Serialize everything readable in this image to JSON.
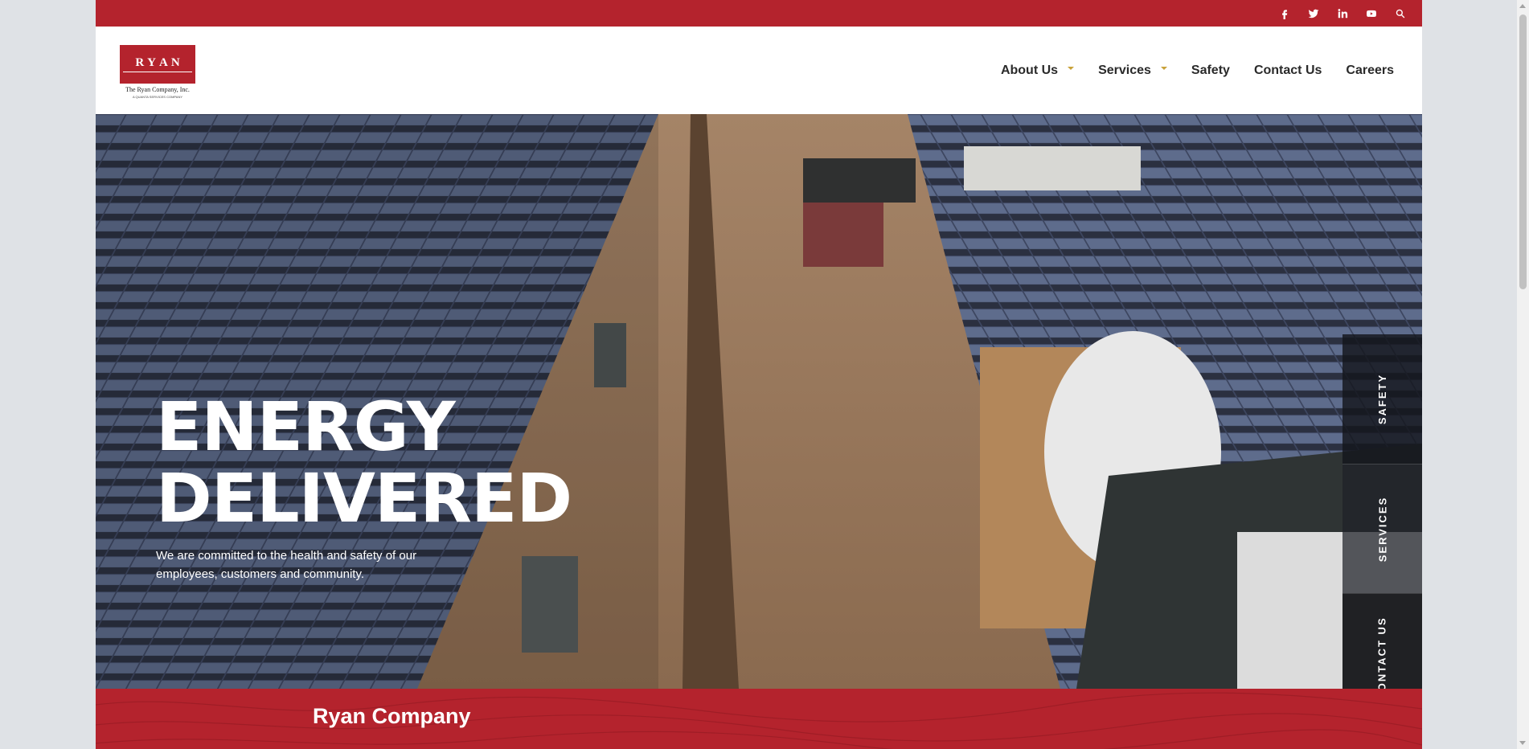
{
  "social": {
    "facebook": "facebook-icon",
    "twitter": "twitter-icon",
    "linkedin": "linkedin-icon",
    "youtube": "youtube-icon",
    "search": "search-icon"
  },
  "logo": {
    "letters": [
      "R",
      "Y",
      "A",
      "N"
    ],
    "company": "The Ryan Company, Inc.",
    "tagline": "A QUANTA SERVICES COMPANY"
  },
  "nav": {
    "items": [
      {
        "label": "About Us",
        "dropdown": true
      },
      {
        "label": "Services",
        "dropdown": true
      },
      {
        "label": "Safety",
        "dropdown": false
      },
      {
        "label": "Contact Us",
        "dropdown": false
      },
      {
        "label": "Careers",
        "dropdown": false
      }
    ]
  },
  "hero": {
    "title_line1": "ENERGY",
    "title_line2": "DELIVERED",
    "subtitle": "We are committed to the health and safety of our employees, customers and community."
  },
  "side_tabs": [
    "SAFETY",
    "SERVICES",
    "CONTACT US"
  ],
  "band": {
    "title": "Ryan Company"
  },
  "colors": {
    "brand_red": "#b4232d",
    "caret_gold": "#c9a23a"
  }
}
